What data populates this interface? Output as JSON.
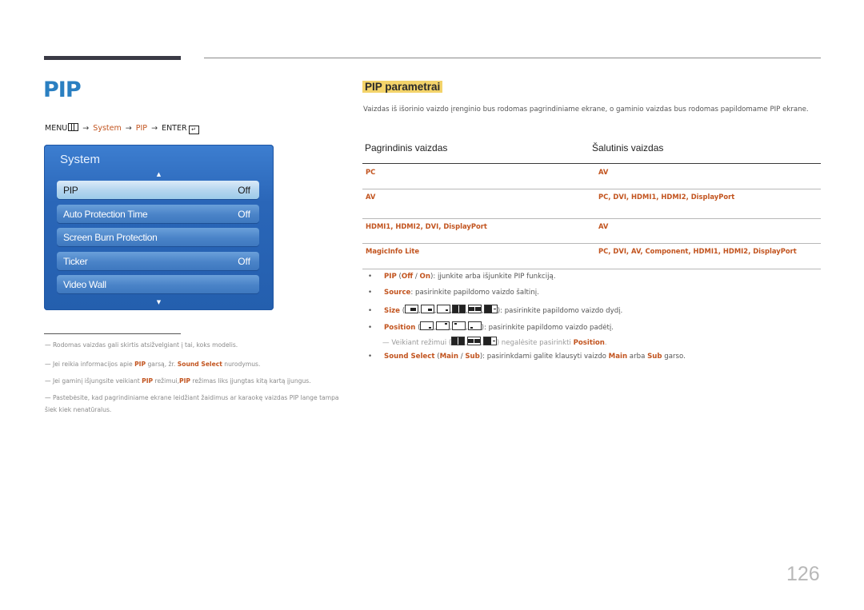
{
  "page": {
    "title": "PIP",
    "page_number": "126"
  },
  "menu_path": {
    "menu": "MENU",
    "arrow": "→",
    "system": "System",
    "pip": "PIP",
    "enter": "ENTER",
    "icon_menu": "menu-icon",
    "icon_enter": "enter-icon"
  },
  "osd": {
    "title": "System",
    "up_arrow": "▲",
    "down_arrow": "▼",
    "items": [
      {
        "label": "PIP",
        "value": "Off",
        "selected": true
      },
      {
        "label": "Auto Protection Time",
        "value": "Off",
        "selected": false
      },
      {
        "label": "Screen Burn Protection",
        "value": "",
        "selected": false
      },
      {
        "label": "Ticker",
        "value": "Off",
        "selected": false
      },
      {
        "label": "Video Wall",
        "value": "",
        "selected": false
      }
    ]
  },
  "notes": [
    {
      "dash": "—",
      "parts": [
        {
          "t": "Rodomas vaizdas gali skirtis atsižvelgiant į tai, koks modelis.",
          "h": false
        }
      ]
    },
    {
      "dash": "—",
      "parts": [
        {
          "t": "Jei reikia informacijos apie ",
          "h": false
        },
        {
          "t": "PIP",
          "h": true
        },
        {
          "t": " garsą, žr. ",
          "h": false
        },
        {
          "t": "Sound Select",
          "h": true
        },
        {
          "t": " nurodymus.",
          "h": false
        }
      ]
    },
    {
      "dash": "—",
      "parts": [
        {
          "t": "Jei gaminį išjungsite veikiant ",
          "h": false
        },
        {
          "t": "PIP",
          "h": true
        },
        {
          "t": " režimui,",
          "h": false
        },
        {
          "t": "PIP",
          "h": true
        },
        {
          "t": " režimas liks įjungtas kitą kartą įjungus.",
          "h": false
        }
      ]
    },
    {
      "dash": "—",
      "parts": [
        {
          "t": "Pastebėsite, kad pagrindiniame ekrane leidžiant žaidimus ar karaokę vaizdas PIP lange tampa šiek kiek nenatūralus.",
          "h": false
        }
      ]
    }
  ],
  "section": {
    "title": "PIP parametrai",
    "intro": "Vaizdas iš išorinio vaizdo įrenginio bus rodomas pagrindiniame ekrane, o gaminio vaizdas bus rodomas papildomame PIP ekrane."
  },
  "table": {
    "headers": [
      "Pagrindinis vaizdas",
      "Šalutinis vaizdas"
    ],
    "rows": [
      [
        "PC",
        "AV"
      ],
      [
        "AV",
        "PC, DVI, HDMI1, HDMI2, DisplayPort"
      ],
      [
        "HDMI1, HDMI2, DVI, DisplayPort",
        "AV"
      ],
      [
        "MagicInfo Lite",
        "PC, DVI, AV, Component, HDMI1, HDMI2, DisplayPort"
      ]
    ]
  },
  "bullets": {
    "dot": "•",
    "pip": {
      "name": "PIP",
      "open": " (",
      "off": "Off",
      "slash": " / ",
      "on": "On",
      "close": ")",
      "desc": ": įjunkite arba išjunkite PIP funkciją."
    },
    "source": {
      "name": "Source",
      "desc": ": pasirinkite papildomo vaizdo šaltinį."
    },
    "size": {
      "name": "Size",
      "open": " (",
      "close": ")",
      "desc": ": pasirinkite papildomo vaizdo dydį.",
      "icons": [
        "size-large-icon",
        "size-medium-icon",
        "size-small-icon",
        "size-split-equal-icon",
        "size-split-wide-icon",
        "size-split-main-icon"
      ]
    },
    "position": {
      "name": "Position",
      "open": " (",
      "close": ")",
      "desc": ": pasirinkite papildomo vaizdo padėtį.",
      "icons": [
        "position-bottom-right-icon",
        "position-top-right-icon",
        "position-top-left-icon",
        "position-bottom-left-icon"
      ]
    },
    "position_note": {
      "dash": "—",
      "pre": " Veikiant režimui (",
      "post": ") negalėsite pasirinkti ",
      "hl": "Position",
      "end": "."
    },
    "sound": {
      "name": "Sound Select",
      "open": " (",
      "main": "Main",
      "slash": " / ",
      "sub": "Sub",
      "close": ")",
      "desc": ": pasirinkdami galite klausyti vaizdo ",
      "main2": "Main",
      "mid": " arba ",
      "sub2": "Sub",
      "end": " garso."
    }
  }
}
